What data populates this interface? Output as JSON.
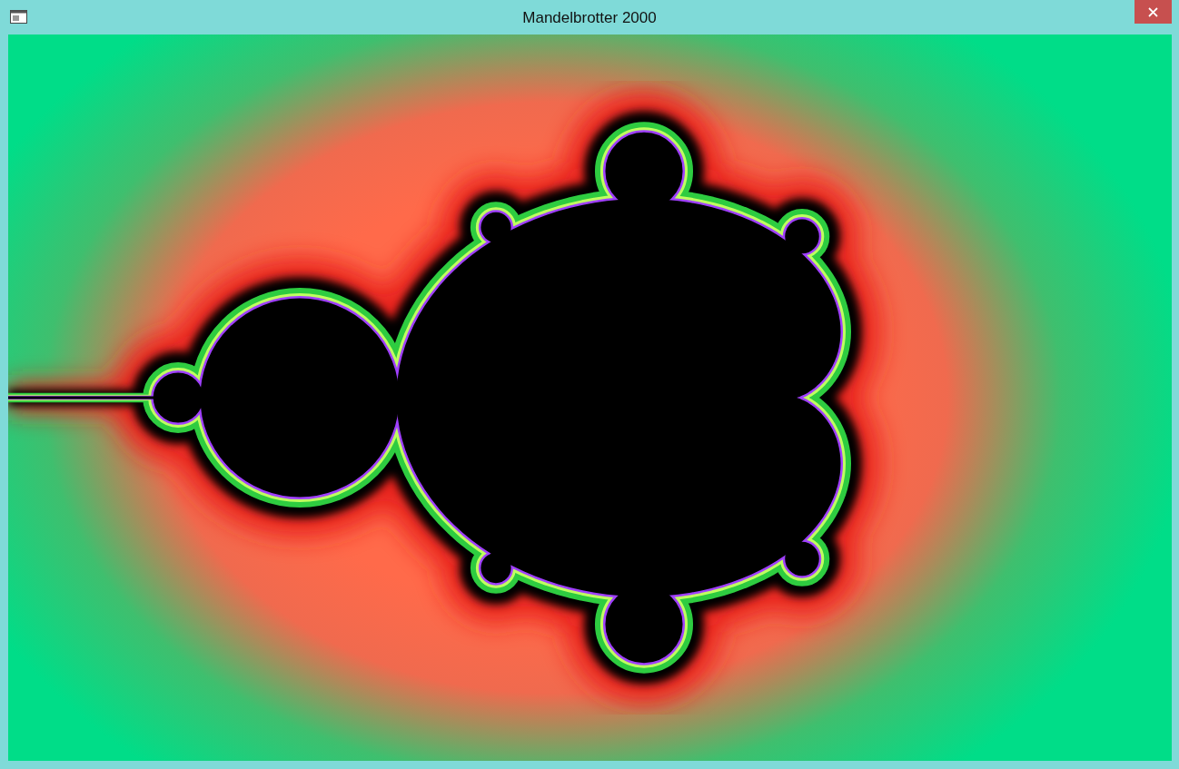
{
  "window": {
    "title": "Mandelbrotter 2000"
  }
}
